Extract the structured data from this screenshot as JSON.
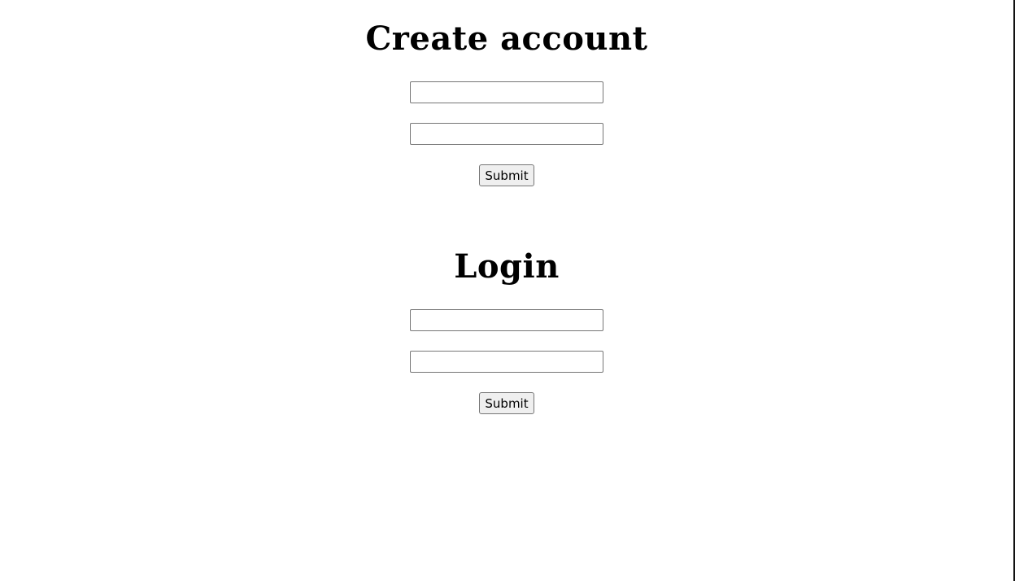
{
  "create_account": {
    "title": "Create account",
    "field_1": {
      "value": "",
      "placeholder": ""
    },
    "field_2": {
      "value": "",
      "placeholder": ""
    },
    "submit_label": "Submit"
  },
  "login": {
    "title": "Login",
    "field_1": {
      "value": "",
      "placeholder": ""
    },
    "field_2": {
      "value": "",
      "placeholder": ""
    },
    "submit_label": "Submit"
  }
}
